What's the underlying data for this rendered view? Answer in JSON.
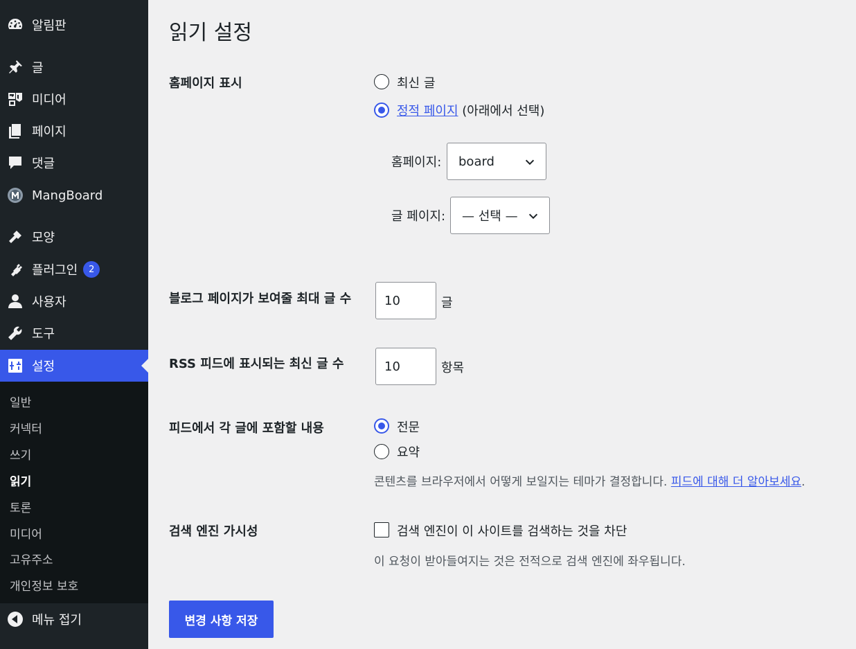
{
  "sidebar": {
    "items": [
      {
        "label": "알림판",
        "icon": "dashboard-icon"
      },
      {
        "label": "글",
        "icon": "pin-icon"
      },
      {
        "label": "미디어",
        "icon": "media-icon"
      },
      {
        "label": "페이지",
        "icon": "page-icon"
      },
      {
        "label": "댓글",
        "icon": "comment-icon"
      },
      {
        "label": "MangBoard",
        "icon": "mangboard-logo-icon"
      },
      {
        "label": "모양",
        "icon": "brush-icon"
      },
      {
        "label": "플러그인",
        "icon": "plugin-icon",
        "badge": "2"
      },
      {
        "label": "사용자",
        "icon": "user-icon"
      },
      {
        "label": "도구",
        "icon": "wrench-icon"
      },
      {
        "label": "설정",
        "icon": "settings-icon"
      }
    ],
    "submenu": [
      "일반",
      "커넥터",
      "쓰기",
      "읽기",
      "토론",
      "미디어",
      "고유주소",
      "개인정보 보호"
    ],
    "collapse_label": "메뉴 접기"
  },
  "page": {
    "title": "읽기 설정",
    "homepage_display": {
      "label": "홈페이지 표시",
      "option_latest": "최신 글",
      "option_static_link": "정적 페이지",
      "option_static_suffix": "(아래에서 선택)",
      "homepage_label": "홈페이지:",
      "homepage_value": "board",
      "posts_page_label": "글 페이지:",
      "posts_page_value": "— 선택 —"
    },
    "posts_per_page": {
      "label": "블로그 페이지가 보여줄 최대 글 수",
      "value": "10",
      "unit": "글"
    },
    "rss_items": {
      "label": "RSS 피드에 표시되는 최신 글 수",
      "value": "10",
      "unit": "항목"
    },
    "feed_content": {
      "label": "피드에서 각 글에 포함할 내용",
      "option_full": "전문",
      "option_excerpt": "요약",
      "desc_text": "콘텐츠를 브라우저에서 어떻게 보일지는 테마가 결정합니다.",
      "desc_link": "피드에 대해 더 알아보세요",
      "desc_end": "."
    },
    "search_visibility": {
      "label": "검색 엔진 가시성",
      "checkbox_label": "검색 엔진이 이 사이트를 검색하는 것을 차단",
      "desc": "이 요청이 받아들여지는 것은 전적으로 검색 엔진에 좌우됩니다."
    },
    "save_label": "변경 사항 저장"
  },
  "colors": {
    "accent": "#3858e9",
    "sidebar": "#1d2327",
    "background": "#f0f0f1"
  }
}
